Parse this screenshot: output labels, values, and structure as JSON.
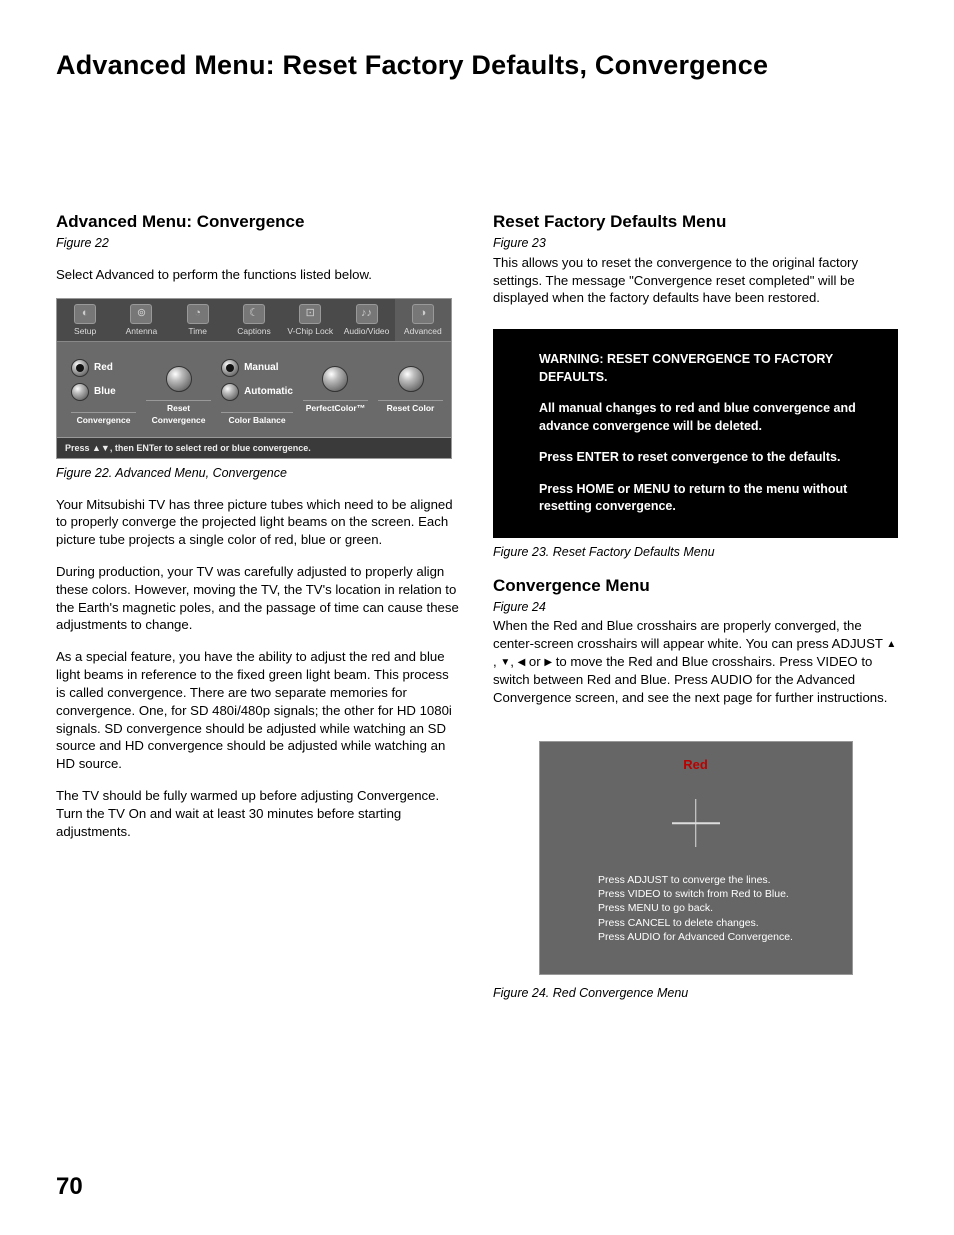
{
  "page_title": "Advanced Menu: Reset Factory Defaults, Convergence",
  "page_number": "70",
  "left": {
    "heading": "Advanced Menu: Convergence",
    "fig_ref": "Figure 22",
    "intro": "Select Advanced to perform the functions listed below.",
    "fig22": {
      "tabs": [
        "Setup",
        "Antenna",
        "Time",
        "Captions",
        "V-Chip Lock",
        "Audio/Video",
        "Advanced"
      ],
      "tab_glyphs": [
        "◐",
        "⊚",
        "◔",
        "☾",
        "⊡",
        "♪♪",
        "◑"
      ],
      "col1": {
        "opt1": "Red",
        "opt2": "Blue",
        "label": "Convergence"
      },
      "col2": {
        "label": "Reset\nConvergence"
      },
      "col3": {
        "opt1": "Manual",
        "opt2": "Automatic",
        "label": "Color Balance"
      },
      "col4": {
        "label": "PerfectColor™"
      },
      "col5": {
        "label": "Reset Color"
      },
      "hint": "Press ▲▼, then ENTer to select red or blue convergence."
    },
    "caption22": "Figure 22. Advanced Menu, Convergence",
    "p1": "Your Mitsubishi TV has three picture tubes which need to be aligned to properly converge the projected light beams on the screen.  Each picture tube projects a single color of red, blue or green.",
    "p2": "During production, your TV was carefully adjusted to properly align these colors.  However, moving the TV, the TV's location in relation to the Earth's magnetic poles, and the passage of time can cause these adjustments to change.",
    "p3": "As a special feature, you have the ability to adjust the red and blue light beams in reference to the fixed green light beam. This process is called convergence. There are two separate memories for convergence. One, for SD 480i/480p signals; the other for HD 1080i signals.  SD convergence should be adjusted while watching an SD source and HD convergence should be adjusted while watching an HD source.",
    "p4": "The TV should be fully warmed up before adjusting Convergence.  Turn the TV On and wait at least 30 minutes before starting adjustments."
  },
  "right": {
    "reset": {
      "heading": "Reset Factory Defaults Menu",
      "fig_ref": "Figure 23",
      "p1": "This allows you to reset the convergence to the original factory settings.  The message \"Convergence reset completed\" will be displayed when the factory defaults have been restored.",
      "warn": {
        "l1": "WARNING:  RESET CONVERGENCE TO FACTORY DEFAULTS.",
        "l2": "All manual changes to red and blue convergence and advance convergence will be deleted.",
        "l3": "Press ENTER to reset convergence to the defaults.",
        "l4": "Press HOME or MENU to return to the menu without resetting convergence."
      },
      "caption23": "Figure 23. Reset Factory Defaults Menu"
    },
    "conv": {
      "heading": "Convergence Menu",
      "fig_ref": "Figure 24",
      "p1a": "When the Red and Blue crosshairs are properly converged, the center-screen crosshairs will appear white. You can press ADJUST ",
      "p1b": " to move the Red and Blue crosshairs.  Press VIDEO to switch between Red and Blue.  Press AUDIO for the Advanced Convergence screen, and see the next page for further instructions.",
      "fig24": {
        "red": "Red",
        "i1": "Press ADJUST to converge the lines.",
        "i2": "Press VIDEO to switch from Red to Blue.",
        "i3": "Press MENU to go back.",
        "i4": "Press CANCEL to delete changes.",
        "i5": "Press AUDIO for Advanced Convergence."
      },
      "caption24": "Figure 24. Red Convergence Menu"
    }
  },
  "glyphs": {
    "up": "▲",
    "down": "▼",
    "left": "◀",
    "right": "▶",
    "comma": ", ",
    "or": " or "
  }
}
